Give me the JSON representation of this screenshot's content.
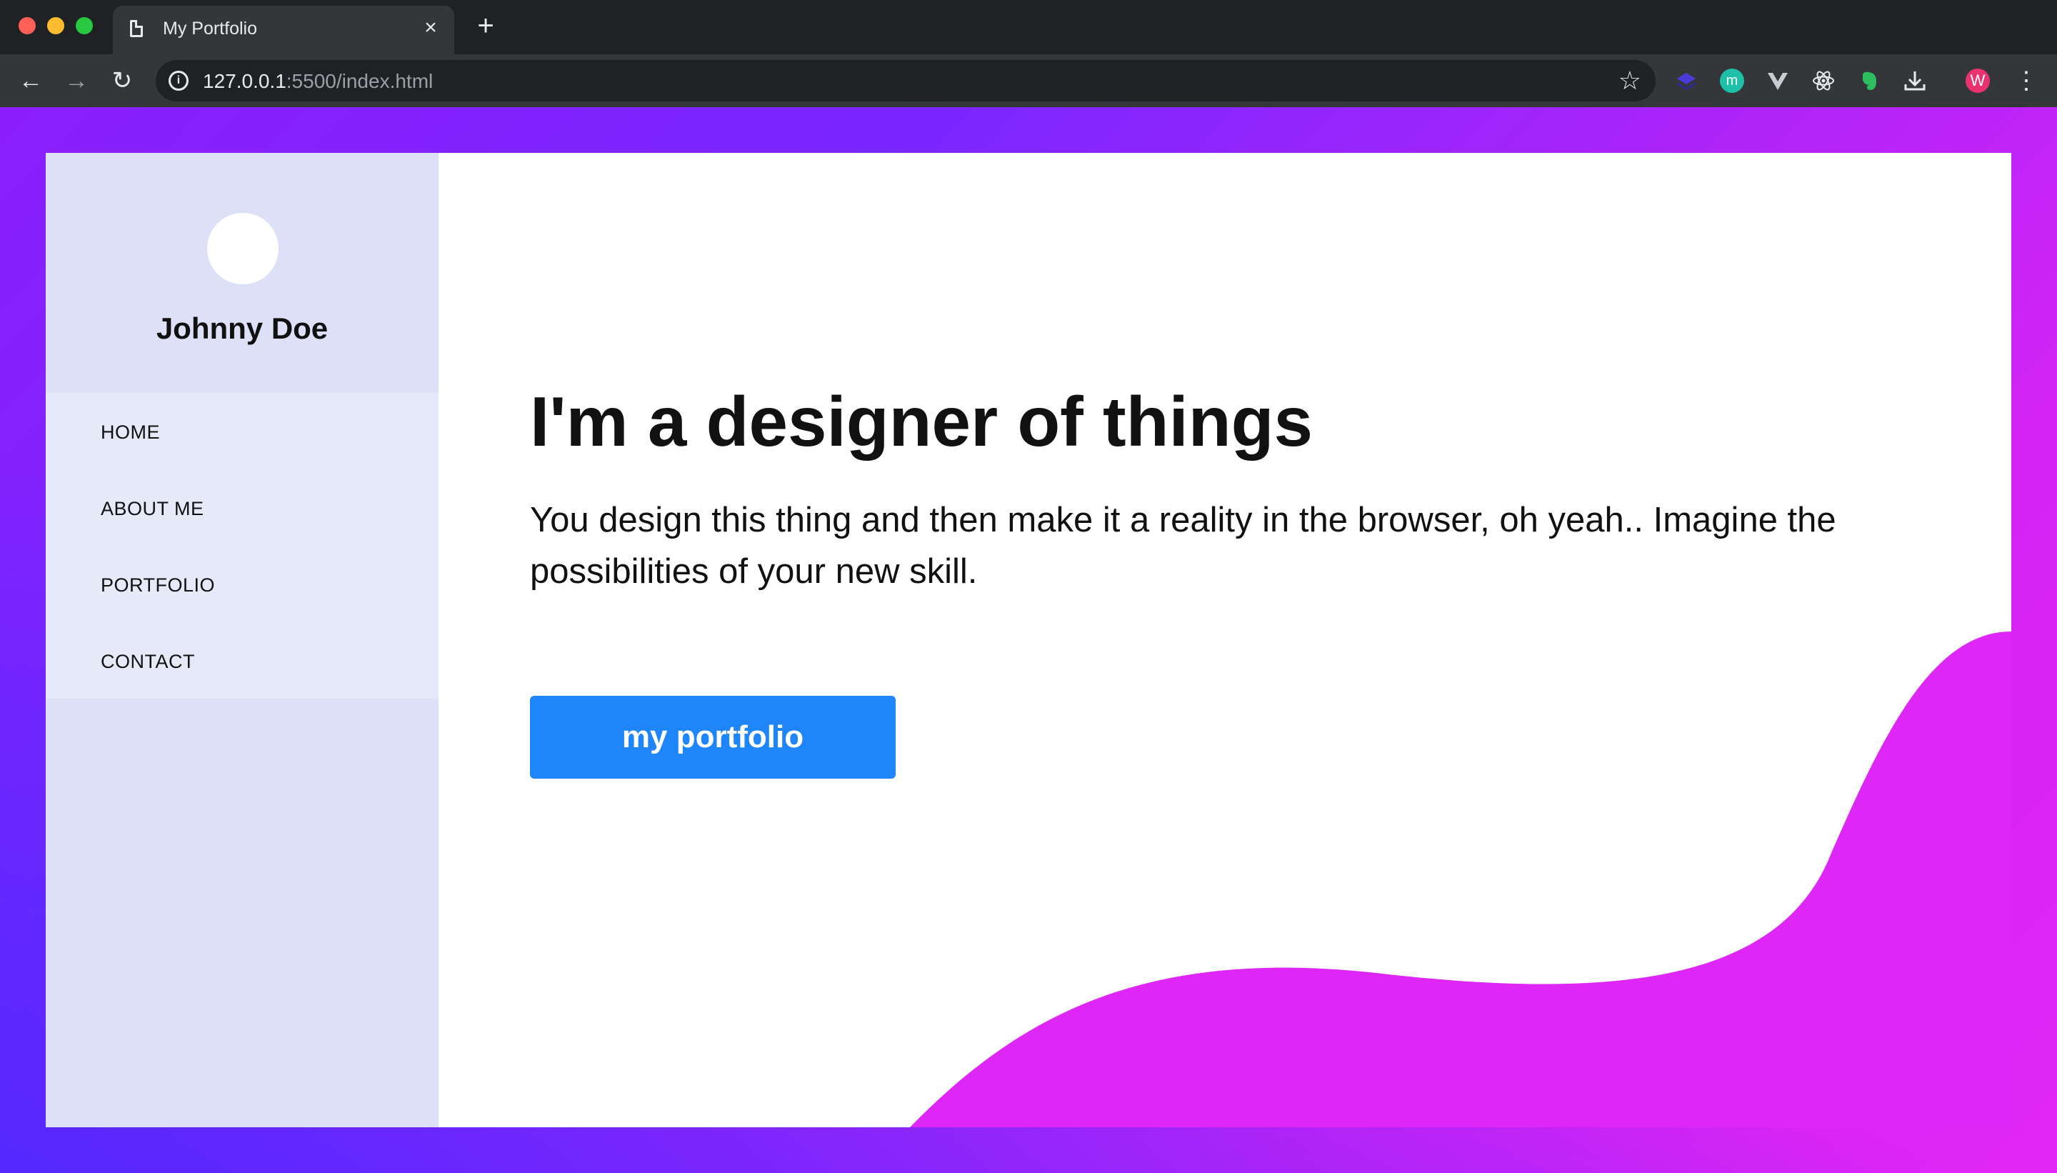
{
  "browser": {
    "tab_title": "My Portfolio",
    "tab_close": "×",
    "new_tab": "+",
    "url_host": "127.0.0.1",
    "url_rest": ":5500/index.html",
    "back": "←",
    "forward": "→",
    "reload": "↻",
    "star": "☆",
    "profile_initial": "W",
    "extensions": [
      "layers-icon",
      "m-icon",
      "vue-icon",
      "react-icon",
      "evernote-icon",
      "download-icon"
    ],
    "ext_m_label": "m"
  },
  "sidebar": {
    "name": "Johnny Doe",
    "nav": [
      {
        "label": "HOME"
      },
      {
        "label": "ABOUT ME"
      },
      {
        "label": "PORTFOLIO"
      },
      {
        "label": "CONTACT"
      }
    ]
  },
  "hero": {
    "headline": "I'm a designer of things",
    "subtitle": "You design this thing and then make it a reality in the browser, oh yeah.. Imagine the possibilities of your new skill.",
    "cta_label": "my portfolio"
  },
  "colors": {
    "accent_blue": "#1f85fa",
    "wave_magenta": "#de26f7",
    "sidebar_bg": "#dde0f6",
    "nav_bg": "#e6e9f8"
  }
}
